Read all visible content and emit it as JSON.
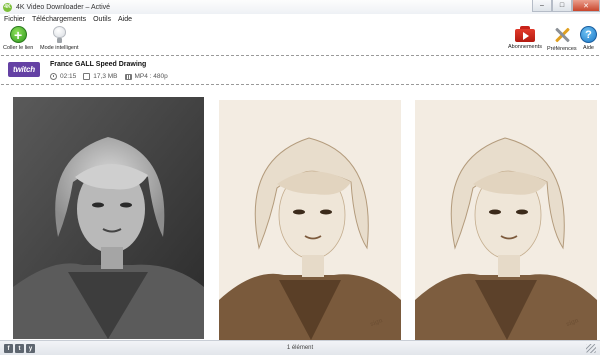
{
  "window": {
    "title": "4K Video Downloader – Activé",
    "app_icon": "4K",
    "controls": {
      "minimize": "–",
      "maximize": "□",
      "close": "✕"
    }
  },
  "menu": {
    "items": [
      "Fichier",
      "Téléchargements",
      "Outils",
      "Aide"
    ]
  },
  "toolbar": {
    "paste_link_label": "Coller le lien",
    "smart_mode_label": "Mode intelligent",
    "subscriptions_label": "Abonnements",
    "preferences_label": "Préférences",
    "help_label": "Aide"
  },
  "download_item": {
    "thumbnail_text": "twitch",
    "title": "France GALL Speed Drawing",
    "duration": "02:15",
    "size": "17,3 MB",
    "format": "MP4 : 480p"
  },
  "status": {
    "count_text": "1 élément",
    "social_icons": [
      "f",
      "t",
      "y"
    ]
  },
  "colors": {
    "accent_green": "#2e9a1d",
    "twitch_purple": "#6441a4",
    "subscriptions_red": "#c8221a",
    "help_blue": "#1c79c9"
  }
}
